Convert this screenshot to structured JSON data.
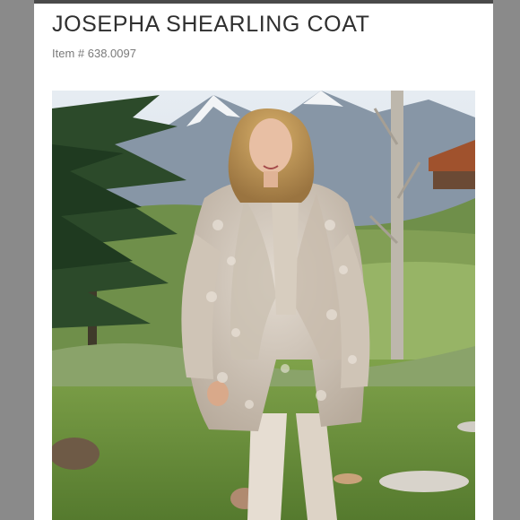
{
  "product": {
    "title": "JOSEPHA SHEARLING COAT",
    "item_number": "Item # 638.0097"
  },
  "photo": {
    "subject": "product-photo"
  },
  "colors": {
    "title_text": "#2f2f2f",
    "item_text": "#7a7a7a",
    "frame": "#8a8a8a",
    "card": "#ffffff"
  }
}
